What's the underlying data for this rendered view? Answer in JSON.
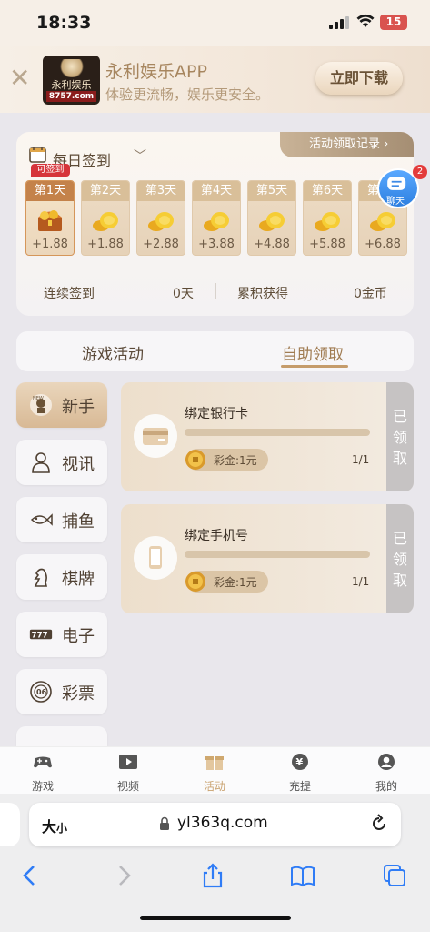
{
  "status_bar": {
    "time": "18:33",
    "battery": "15"
  },
  "banner": {
    "logo_name": "永利娱乐",
    "logo_domain": "8757.com",
    "title": "永利娱乐APP",
    "subtitle": "体验更流畅，娱乐更安全。",
    "download_label": "立即下载"
  },
  "signin": {
    "title": "每日签到",
    "record_link": "活动领取记录 ›",
    "badge": "可签到",
    "days": [
      {
        "label": "第1天",
        "amount": "+1.88"
      },
      {
        "label": "第2天",
        "amount": "+1.88"
      },
      {
        "label": "第3天",
        "amount": "+2.88"
      },
      {
        "label": "第4天",
        "amount": "+3.88"
      },
      {
        "label": "第5天",
        "amount": "+4.88"
      },
      {
        "label": "第6天",
        "amount": "+5.88"
      },
      {
        "label": "第7天",
        "amount": "+6.88"
      }
    ],
    "streak_label": "连续签到",
    "streak_value": "0天",
    "total_label": "累积获得",
    "total_value": "0金币"
  },
  "chat": {
    "label": "聊天",
    "badge": "2"
  },
  "tabs": {
    "games": "游戏活动",
    "self_claim": "自助领取"
  },
  "categories": [
    {
      "label": "新手"
    },
    {
      "label": "视讯"
    },
    {
      "label": "捕鱼"
    },
    {
      "label": "棋牌"
    },
    {
      "label": "电子"
    },
    {
      "label": "彩票"
    }
  ],
  "tasks": [
    {
      "title": "绑定银行卡",
      "reward": "彩金:1元",
      "count": "1/1",
      "status": "已领取",
      "progress": 1.0
    },
    {
      "title": "绑定手机号",
      "reward": "彩金:1元",
      "count": "1/1",
      "status": "已领取",
      "progress": 1.0
    }
  ],
  "bottom_nav": [
    {
      "label": "游戏"
    },
    {
      "label": "视频"
    },
    {
      "label": "活动"
    },
    {
      "label": "充提"
    },
    {
      "label": "我的"
    }
  ],
  "browser": {
    "text_size": "大",
    "text_size_small": "小",
    "url": "yl363q.com"
  },
  "colors": {
    "accent": "#c59c6b",
    "claimed": "#c6c3c3",
    "badge_red": "#d6343a"
  }
}
